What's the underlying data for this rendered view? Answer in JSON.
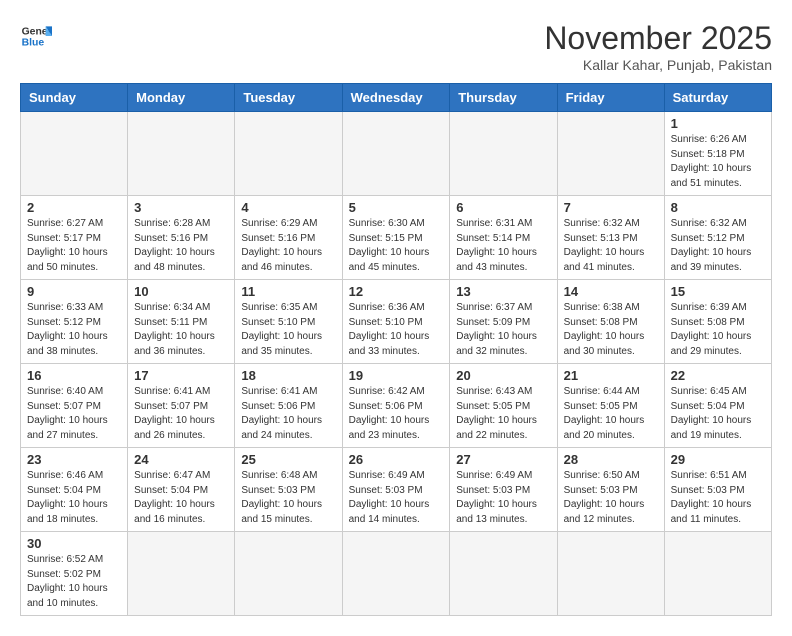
{
  "logo": {
    "line1": "General",
    "line2": "Blue"
  },
  "header": {
    "month_title": "November 2025",
    "subtitle": "Kallar Kahar, Punjab, Pakistan"
  },
  "weekdays": [
    "Sunday",
    "Monday",
    "Tuesday",
    "Wednesday",
    "Thursday",
    "Friday",
    "Saturday"
  ],
  "weeks": [
    [
      {
        "day": "",
        "info": ""
      },
      {
        "day": "",
        "info": ""
      },
      {
        "day": "",
        "info": ""
      },
      {
        "day": "",
        "info": ""
      },
      {
        "day": "",
        "info": ""
      },
      {
        "day": "",
        "info": ""
      },
      {
        "day": "1",
        "info": "Sunrise: 6:26 AM\nSunset: 5:18 PM\nDaylight: 10 hours\nand 51 minutes."
      }
    ],
    [
      {
        "day": "2",
        "info": "Sunrise: 6:27 AM\nSunset: 5:17 PM\nDaylight: 10 hours\nand 50 minutes."
      },
      {
        "day": "3",
        "info": "Sunrise: 6:28 AM\nSunset: 5:16 PM\nDaylight: 10 hours\nand 48 minutes."
      },
      {
        "day": "4",
        "info": "Sunrise: 6:29 AM\nSunset: 5:16 PM\nDaylight: 10 hours\nand 46 minutes."
      },
      {
        "day": "5",
        "info": "Sunrise: 6:30 AM\nSunset: 5:15 PM\nDaylight: 10 hours\nand 45 minutes."
      },
      {
        "day": "6",
        "info": "Sunrise: 6:31 AM\nSunset: 5:14 PM\nDaylight: 10 hours\nand 43 minutes."
      },
      {
        "day": "7",
        "info": "Sunrise: 6:32 AM\nSunset: 5:13 PM\nDaylight: 10 hours\nand 41 minutes."
      },
      {
        "day": "8",
        "info": "Sunrise: 6:32 AM\nSunset: 5:12 PM\nDaylight: 10 hours\nand 39 minutes."
      }
    ],
    [
      {
        "day": "9",
        "info": "Sunrise: 6:33 AM\nSunset: 5:12 PM\nDaylight: 10 hours\nand 38 minutes."
      },
      {
        "day": "10",
        "info": "Sunrise: 6:34 AM\nSunset: 5:11 PM\nDaylight: 10 hours\nand 36 minutes."
      },
      {
        "day": "11",
        "info": "Sunrise: 6:35 AM\nSunset: 5:10 PM\nDaylight: 10 hours\nand 35 minutes."
      },
      {
        "day": "12",
        "info": "Sunrise: 6:36 AM\nSunset: 5:10 PM\nDaylight: 10 hours\nand 33 minutes."
      },
      {
        "day": "13",
        "info": "Sunrise: 6:37 AM\nSunset: 5:09 PM\nDaylight: 10 hours\nand 32 minutes."
      },
      {
        "day": "14",
        "info": "Sunrise: 6:38 AM\nSunset: 5:08 PM\nDaylight: 10 hours\nand 30 minutes."
      },
      {
        "day": "15",
        "info": "Sunrise: 6:39 AM\nSunset: 5:08 PM\nDaylight: 10 hours\nand 29 minutes."
      }
    ],
    [
      {
        "day": "16",
        "info": "Sunrise: 6:40 AM\nSunset: 5:07 PM\nDaylight: 10 hours\nand 27 minutes."
      },
      {
        "day": "17",
        "info": "Sunrise: 6:41 AM\nSunset: 5:07 PM\nDaylight: 10 hours\nand 26 minutes."
      },
      {
        "day": "18",
        "info": "Sunrise: 6:41 AM\nSunset: 5:06 PM\nDaylight: 10 hours\nand 24 minutes."
      },
      {
        "day": "19",
        "info": "Sunrise: 6:42 AM\nSunset: 5:06 PM\nDaylight: 10 hours\nand 23 minutes."
      },
      {
        "day": "20",
        "info": "Sunrise: 6:43 AM\nSunset: 5:05 PM\nDaylight: 10 hours\nand 22 minutes."
      },
      {
        "day": "21",
        "info": "Sunrise: 6:44 AM\nSunset: 5:05 PM\nDaylight: 10 hours\nand 20 minutes."
      },
      {
        "day": "22",
        "info": "Sunrise: 6:45 AM\nSunset: 5:04 PM\nDaylight: 10 hours\nand 19 minutes."
      }
    ],
    [
      {
        "day": "23",
        "info": "Sunrise: 6:46 AM\nSunset: 5:04 PM\nDaylight: 10 hours\nand 18 minutes."
      },
      {
        "day": "24",
        "info": "Sunrise: 6:47 AM\nSunset: 5:04 PM\nDaylight: 10 hours\nand 16 minutes."
      },
      {
        "day": "25",
        "info": "Sunrise: 6:48 AM\nSunset: 5:03 PM\nDaylight: 10 hours\nand 15 minutes."
      },
      {
        "day": "26",
        "info": "Sunrise: 6:49 AM\nSunset: 5:03 PM\nDaylight: 10 hours\nand 14 minutes."
      },
      {
        "day": "27",
        "info": "Sunrise: 6:49 AM\nSunset: 5:03 PM\nDaylight: 10 hours\nand 13 minutes."
      },
      {
        "day": "28",
        "info": "Sunrise: 6:50 AM\nSunset: 5:03 PM\nDaylight: 10 hours\nand 12 minutes."
      },
      {
        "day": "29",
        "info": "Sunrise: 6:51 AM\nSunset: 5:03 PM\nDaylight: 10 hours\nand 11 minutes."
      }
    ],
    [
      {
        "day": "30",
        "info": "Sunrise: 6:52 AM\nSunset: 5:02 PM\nDaylight: 10 hours\nand 10 minutes."
      },
      {
        "day": "",
        "info": ""
      },
      {
        "day": "",
        "info": ""
      },
      {
        "day": "",
        "info": ""
      },
      {
        "day": "",
        "info": ""
      },
      {
        "day": "",
        "info": ""
      },
      {
        "day": "",
        "info": ""
      }
    ]
  ]
}
